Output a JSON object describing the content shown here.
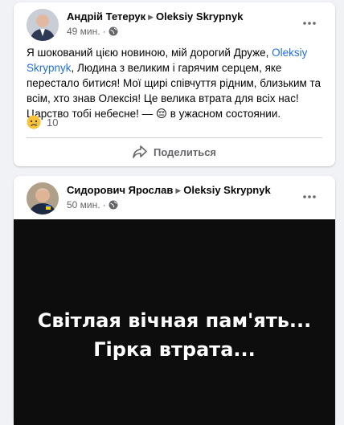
{
  "posts": [
    {
      "author": "Андрій Тетерук",
      "target": "Oleksiy Skrypnyk",
      "time": "49 мин.",
      "text_before": "Я шокований цією новиною, мій дорогий Друже, ",
      "mention": "Oleksiy Skrypnyk",
      "text_after": ", Людина з великим і гарячим серцем, яке перестало битися! Мої щирі співчуття рідним, близьким та всім, хто знав Олексія! Це велика втрата для всіх нас!Царство тобі небесне! — 😔  в ужасном состоянии.",
      "reaction_icon": "sad-emoji",
      "reaction_count": "10",
      "share_label": "Поделиться"
    },
    {
      "author": "Сидорович Ярослав",
      "target": "Oleksiy Skrypnyk",
      "time": "50 мин.",
      "image_line1": "Світлая вічная пам'ять...",
      "image_line2": "Гірка втрата..."
    }
  ],
  "colors": {
    "background": "#f0f2f5",
    "mention": "#216fdb",
    "secondary_text": "#65676b",
    "media_background": "#0d0d0d"
  }
}
